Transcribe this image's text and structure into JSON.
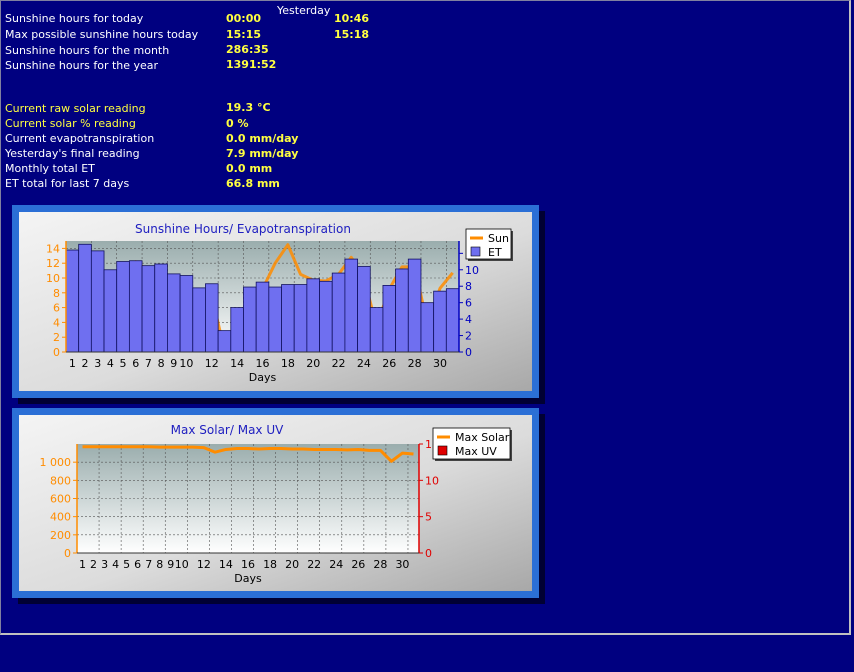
{
  "header": {
    "yesterday_label": "Yesterday"
  },
  "stats": [
    {
      "label": "Sunshine hours for today",
      "value": "00:00",
      "yesterday": "10:46",
      "label_color": "white"
    },
    {
      "label": "Max possible sunshine hours today",
      "value": "15:15",
      "yesterday": "15:18",
      "label_color": "white"
    },
    {
      "label": "Sunshine hours for the month",
      "value": "286:35",
      "yesterday": "",
      "label_color": "white"
    },
    {
      "label": "Sunshine hours for the year",
      "value": "1391:52",
      "yesterday": "",
      "label_color": "white"
    }
  ],
  "readings": [
    {
      "label": "Current raw solar reading",
      "value": "19.3 °C",
      "label_color": "yellow"
    },
    {
      "label": "Current solar % reading",
      "value": "0 %",
      "label_color": "yellow"
    },
    {
      "label": "Current evapotranspiration",
      "value": "0.0 mm/day",
      "label_color": "white"
    },
    {
      "label": "Yesterday's final reading",
      "value": "7.9 mm/day",
      "label_color": "white"
    },
    {
      "label": "Monthly total ET",
      "value": "0.0 mm",
      "label_color": "white"
    },
    {
      "label": "ET total for last 7 days",
      "value": "66.8 mm",
      "label_color": "white"
    }
  ],
  "colors": {
    "background": "#000080",
    "sun": "#ff8c00",
    "et_fill": "#6f6ff0",
    "et_edge": "#0000c0",
    "uv": "#e00000",
    "et_axis": "#0000c0",
    "sun_axis": "#ff8c00"
  },
  "chart_data": [
    {
      "type": "bar",
      "title": "Sunshine Hours/ Evapotranspiration",
      "xlabel": "Days",
      "x": [
        1,
        2,
        3,
        4,
        5,
        6,
        7,
        8,
        9,
        10,
        11,
        12,
        13,
        14,
        15,
        16,
        17,
        18,
        19,
        20,
        21,
        22,
        23,
        24,
        25,
        26,
        27,
        28,
        29,
        30,
        31
      ],
      "x_tick_labels": [
        "1",
        "2",
        "3",
        "4",
        "5",
        "6",
        "7",
        "8",
        "9",
        "10",
        "",
        "12",
        "",
        "14",
        "",
        "16",
        "",
        "18",
        "",
        "20",
        "",
        "22",
        "",
        "24",
        "",
        "26",
        "",
        "28",
        "",
        "30",
        ""
      ],
      "left_axis": {
        "ylim": [
          0,
          15
        ],
        "ticks": [
          0,
          2,
          4,
          6,
          8,
          10,
          12,
          14
        ]
      },
      "right_axis": {
        "ylim": [
          0,
          13.5
        ],
        "ticks": [
          0,
          2,
          4,
          6,
          8,
          10,
          12
        ]
      },
      "grid": true,
      "legend_position": "top-right",
      "series": [
        {
          "name": "Sun",
          "type": "line",
          "axis": "left",
          "color": "#ff8c00",
          "values": [
            11.2,
            12.5,
            9.8,
            9.4,
            10.5,
            12.2,
            11.0,
            9.0,
            6.5,
            7.3,
            8.5,
            7.6,
            0.2,
            2.0,
            7.5,
            8.5,
            12.0,
            14.5,
            10.5,
            9.7,
            9.6,
            10.5,
            12.8,
            10.0,
            3.5,
            8.5,
            11.5,
            11.5,
            3.8,
            8.6,
            10.7
          ]
        },
        {
          "name": "ET",
          "type": "bar",
          "axis": "right",
          "color": "#6f6ff0",
          "values": [
            12.4,
            13.1,
            12.3,
            10.0,
            11.0,
            11.1,
            10.5,
            10.7,
            9.5,
            9.3,
            7.8,
            8.3,
            2.6,
            5.4,
            7.9,
            8.5,
            7.9,
            8.2,
            8.2,
            8.9,
            8.6,
            9.6,
            11.3,
            10.4,
            5.4,
            8.1,
            10.1,
            11.3,
            6.0,
            7.4,
            7.7
          ]
        }
      ]
    },
    {
      "type": "line",
      "title": "Max Solar/ Max UV",
      "xlabel": "Days",
      "x": [
        1,
        2,
        3,
        4,
        5,
        6,
        7,
        8,
        9,
        10,
        11,
        12,
        13,
        14,
        15,
        16,
        17,
        18,
        19,
        20,
        21,
        22,
        23,
        24,
        25,
        26,
        27,
        28,
        29,
        30,
        31
      ],
      "x_tick_labels": [
        "1",
        "2",
        "3",
        "4",
        "5",
        "6",
        "7",
        "8",
        "9",
        "10",
        "",
        "12",
        "",
        "14",
        "",
        "16",
        "",
        "18",
        "",
        "20",
        "",
        "22",
        "",
        "24",
        "",
        "26",
        "",
        "28",
        "",
        "30",
        ""
      ],
      "left_axis": {
        "ylim": [
          0,
          1200
        ],
        "ticks": [
          0,
          200,
          400,
          600,
          800,
          1000
        ],
        "tick_labels": [
          "0",
          "200",
          "400",
          "600",
          "800",
          "1 000"
        ]
      },
      "right_axis": {
        "ylim": [
          0,
          15
        ],
        "ticks": [
          0,
          5,
          10,
          15
        ]
      },
      "grid": true,
      "legend_position": "top-right",
      "series": [
        {
          "name": "Max Solar",
          "axis": "left",
          "color": "#ff8c00",
          "values": [
            1170,
            1170,
            1170,
            1170,
            1170,
            1170,
            1170,
            1165,
            1165,
            1165,
            1165,
            1160,
            1110,
            1140,
            1150,
            1150,
            1145,
            1150,
            1150,
            1145,
            1145,
            1140,
            1140,
            1140,
            1135,
            1140,
            1130,
            1130,
            1010,
            1100,
            1090
          ]
        },
        {
          "name": "Max UV",
          "axis": "right",
          "color": "#e00000",
          "values": []
        }
      ]
    }
  ]
}
